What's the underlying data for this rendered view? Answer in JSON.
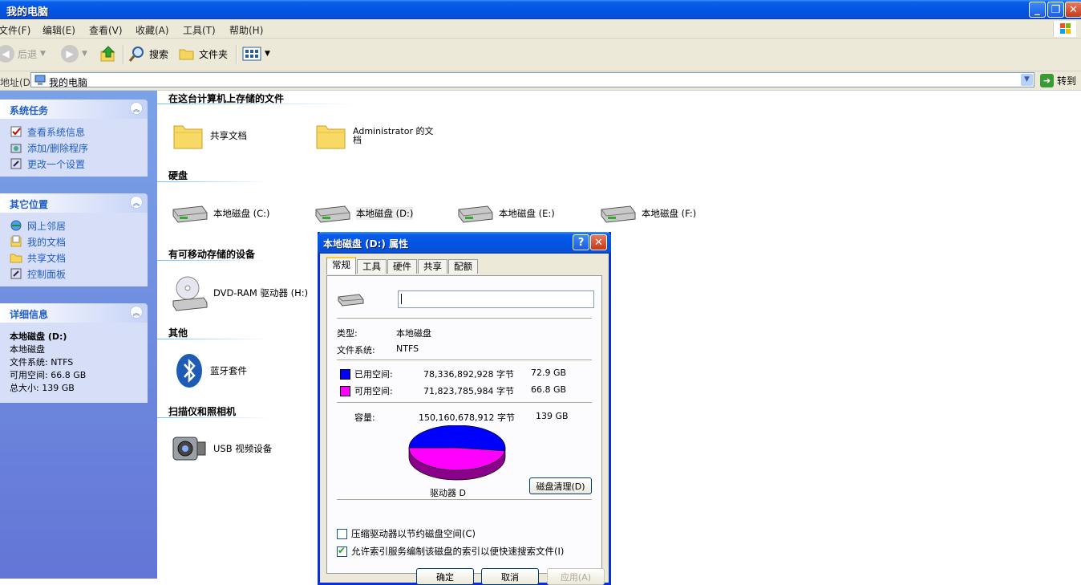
{
  "window": {
    "title": "我的电脑"
  },
  "menu": [
    "文件(F)",
    "编辑(E)",
    "查看(V)",
    "收藏(A)",
    "工具(T)",
    "帮助(H)"
  ],
  "toolbar": {
    "back": "后退",
    "search": "搜索",
    "folders": "文件夹"
  },
  "address": {
    "label": "地址(D)",
    "value": "我的电脑",
    "go": "转到"
  },
  "sidebar": {
    "system_tasks": {
      "title": "系统任务",
      "items": [
        "查看系统信息",
        "添加/删除程序",
        "更改一个设置"
      ]
    },
    "other_places": {
      "title": "其它位置",
      "items": [
        "网上邻居",
        "我的文档",
        "共享文档",
        "控制面板"
      ]
    },
    "details": {
      "title": "详细信息",
      "name": "本地磁盘 (D:)",
      "type": "本地磁盘",
      "fs": "文件系统: NTFS",
      "free": "可用空间: 66.8 GB",
      "total": "总大小: 139 GB"
    }
  },
  "groups": {
    "stored": "在这台计算机上存储的文件",
    "hdd": "硬盘",
    "removable": "有可移动存储的设备",
    "other": "其他",
    "scanners": "扫描仪和照相机"
  },
  "items": {
    "shared_docs": "共享文档",
    "admin_docs_1": "Administrator 的文",
    "admin_docs_2": "档",
    "disk_c": "本地磁盘 (C:)",
    "disk_d": "本地磁盘 (D:)",
    "disk_e": "本地磁盘 (E:)",
    "disk_f": "本地磁盘 (F:)",
    "dvd": "DVD-RAM 驱动器 (H:)",
    "bluetooth": "蓝牙套件",
    "usb_video": "USB 视频设备"
  },
  "dialog": {
    "title": "本地磁盘 (D:) 属性",
    "tabs": [
      "常规",
      "工具",
      "硬件",
      "共享",
      "配额"
    ],
    "label_value": "",
    "type_label": "类型:",
    "type_value": "本地磁盘",
    "fs_label": "文件系统:",
    "fs_value": "NTFS",
    "used_label": "已用空间:",
    "used_bytes": "78,336,892,928 字节",
    "used_gb": "72.9 GB",
    "free_label": "可用空间:",
    "free_bytes": "71,823,785,984 字节",
    "free_gb": "66.8 GB",
    "cap_label": "容量:",
    "cap_bytes": "150,160,678,912 字节",
    "cap_gb": "139 GB",
    "drive_label": "驱动器 D",
    "cleanup": "磁盘清理(D)",
    "compress": "压缩驱动器以节约磁盘空间(C)",
    "compress_checked": false,
    "index": "允许索引服务编制该磁盘的索引以便快速搜索文件(I)",
    "index_checked": true,
    "ok": "确定",
    "cancel": "取消",
    "apply": "应用(A)",
    "used_color": "#0000ff",
    "free_color": "#ff00ff",
    "used_fraction": 0.5217
  }
}
